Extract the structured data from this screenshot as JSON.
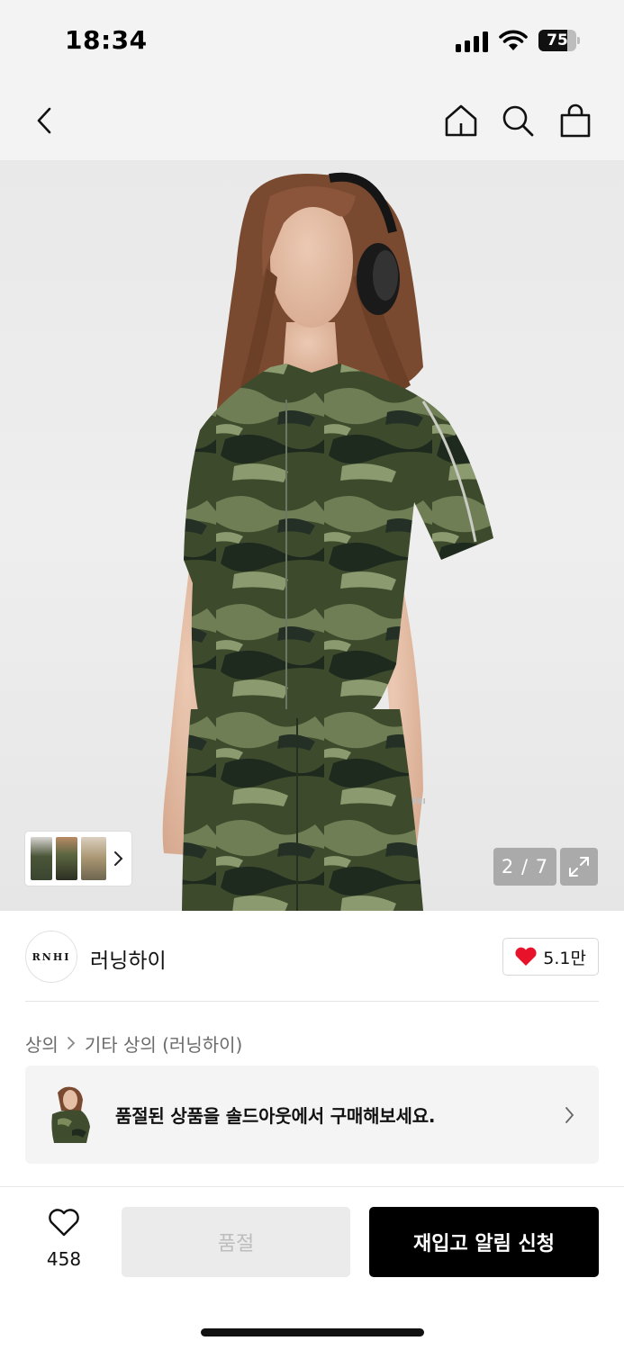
{
  "status_bar": {
    "time": "18:34",
    "battery_level": "75",
    "battery_fraction": 0.75,
    "icons": [
      "signal-icon",
      "wifi-icon",
      "battery-icon"
    ]
  },
  "nav": {
    "icons": [
      "back-icon",
      "home-icon",
      "search-icon",
      "shopping-bag-icon"
    ]
  },
  "gallery": {
    "page_indicator": "2 / 7",
    "thumbnail_icon": "chevron-right-icon",
    "expand_icon": "expand-icon"
  },
  "brand": {
    "logo_text": "RNHI",
    "name": "러닝하이",
    "likes": "5.1만",
    "like_icon": "heart-filled-icon",
    "like_color": "#e8132a"
  },
  "breadcrumb": {
    "items": [
      "상의",
      "기타 상의 (러닝하이)"
    ]
  },
  "soldout_banner": {
    "text": "품절된 상품을 솔드아웃에서 구매해보세요."
  },
  "bottom_bar": {
    "wish_count": "458",
    "soldout_label": "품절",
    "restock_label": "재입고 알림 신청"
  }
}
